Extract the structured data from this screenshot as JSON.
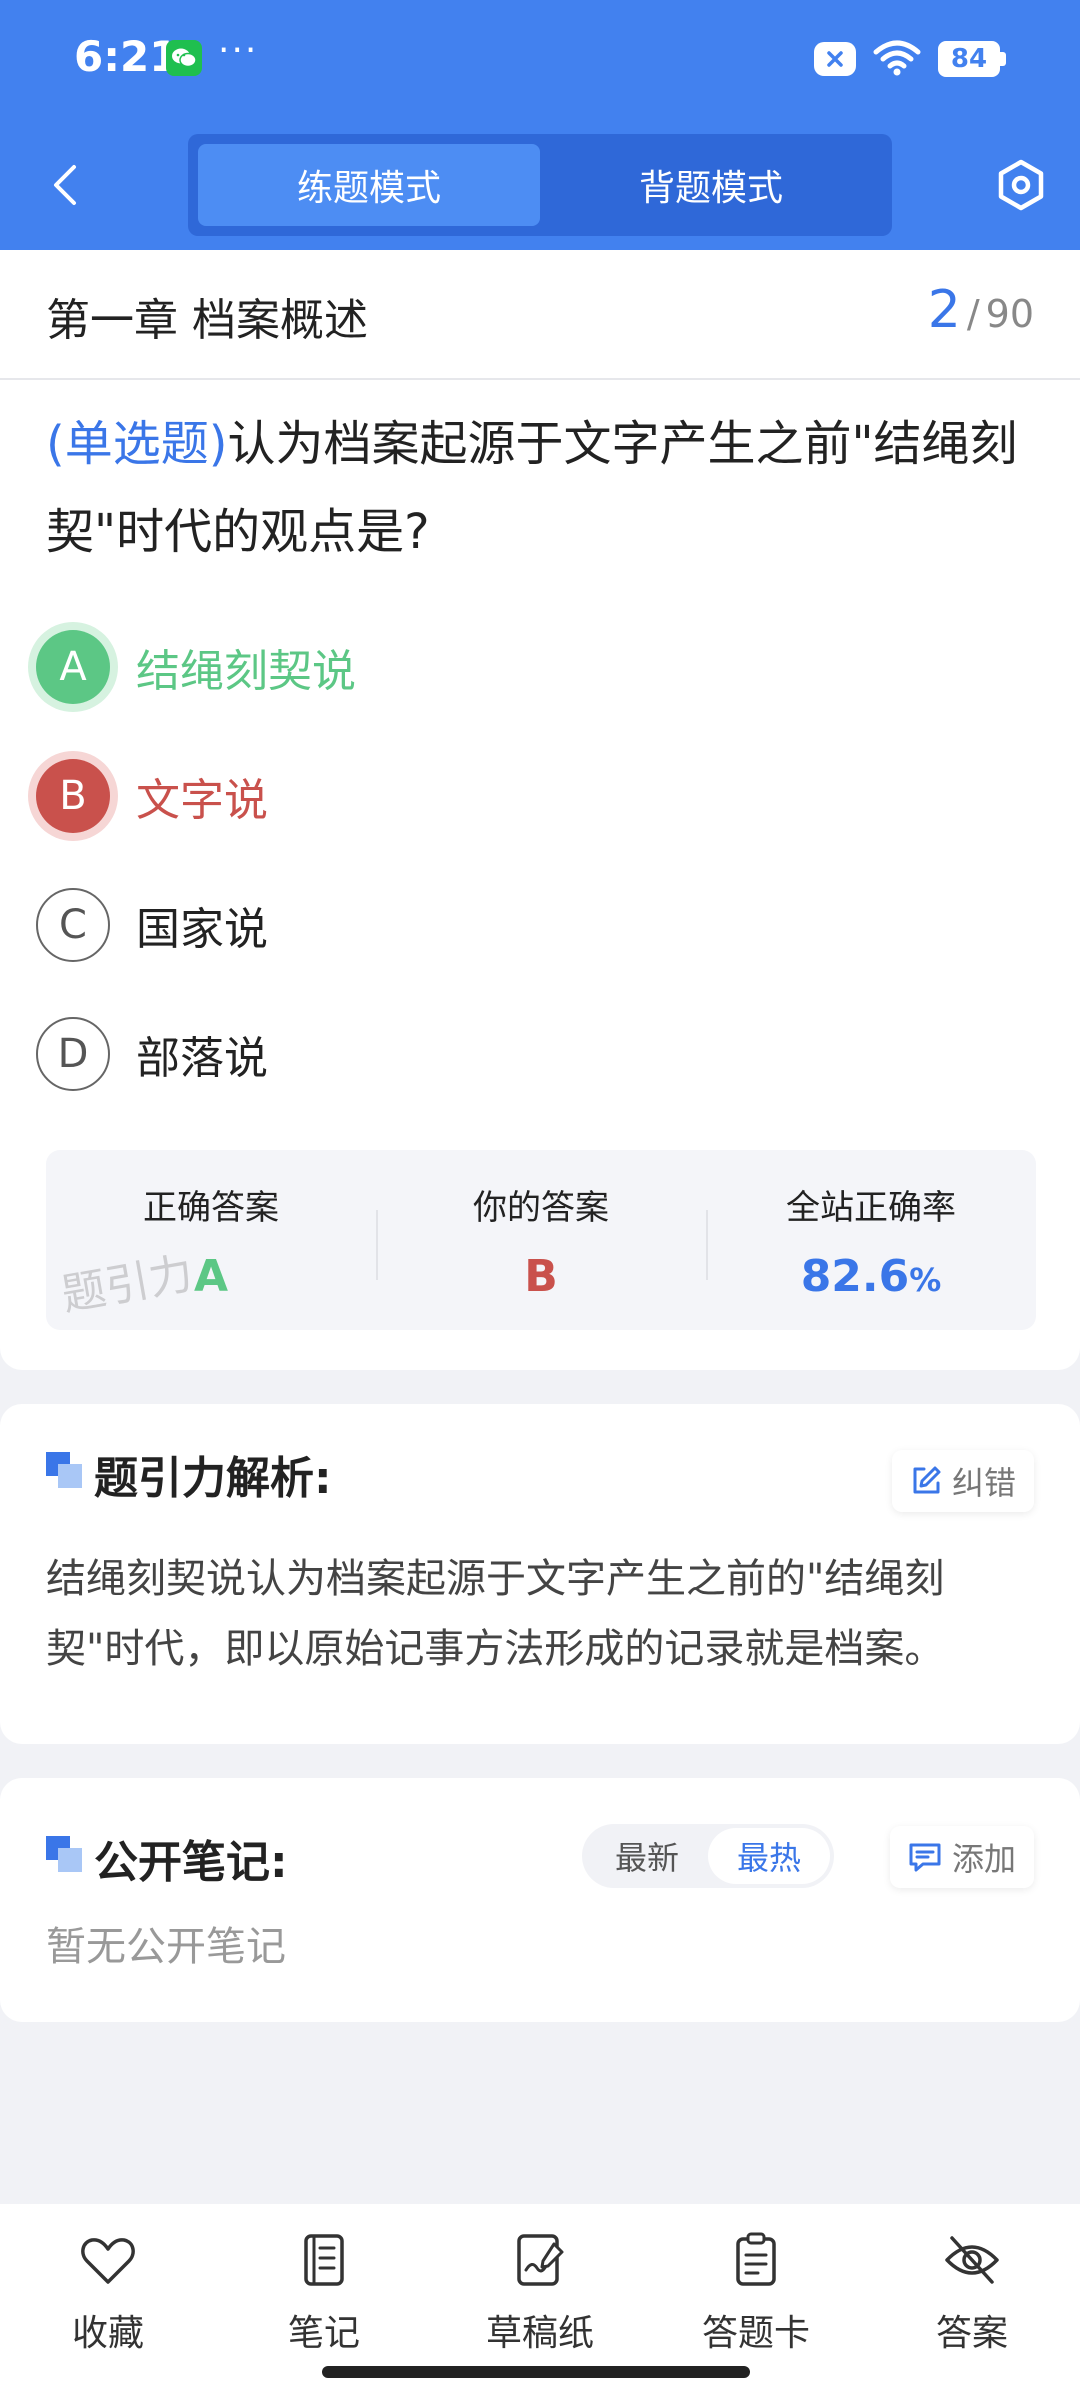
{
  "status_bar": {
    "time": "6:21",
    "dots": "···",
    "battery": "84"
  },
  "nav": {
    "tabs": [
      {
        "label": "练题模式",
        "active": true
      },
      {
        "label": "背题模式",
        "active": false
      }
    ]
  },
  "question_card": {
    "chapter": "第一章 档案概述",
    "counter": {
      "current": "2",
      "separator": "/",
      "total": "90"
    },
    "question_type": "(单选题)",
    "question_text": "认为档案起源于文字产生之前\"结绳刻契\"时代的观点是?",
    "options": [
      {
        "letter": "A",
        "text": "结绳刻契说",
        "state": "correct"
      },
      {
        "letter": "B",
        "text": "文字说",
        "state": "wrong"
      },
      {
        "letter": "C",
        "text": "国家说",
        "state": "normal"
      },
      {
        "letter": "D",
        "text": "部落说",
        "state": "normal"
      }
    ],
    "result": {
      "correct_label": "正确答案",
      "correct_value": "A",
      "yours_label": "你的答案",
      "yours_value": "B",
      "rate_label": "全站正确率",
      "rate_value": "82.6",
      "rate_unit": "%"
    },
    "watermark": "题引力"
  },
  "analysis": {
    "title": "题引力解析:",
    "report_label": "纠错",
    "text": "结绳刻契说认为档案起源于文字产生之前的\"结绳刻契\"时代，即以原始记事方法形成的记录就是档案。"
  },
  "notes": {
    "title": "公开笔记:",
    "sort": [
      {
        "label": "最新",
        "active": false
      },
      {
        "label": "最热",
        "active": true
      }
    ],
    "add_label": "添加",
    "empty_text": "暂无公开笔记"
  },
  "bottom_bar": [
    {
      "label": "收藏",
      "icon": "heart-icon"
    },
    {
      "label": "笔记",
      "icon": "notebook-icon"
    },
    {
      "label": "草稿纸",
      "icon": "draft-icon"
    },
    {
      "label": "答题卡",
      "icon": "clipboard-icon"
    },
    {
      "label": "答案",
      "icon": "eye-off-icon"
    }
  ],
  "colors": {
    "primary": "#4281ef",
    "correct": "#5cc785",
    "wrong": "#c9514c"
  }
}
